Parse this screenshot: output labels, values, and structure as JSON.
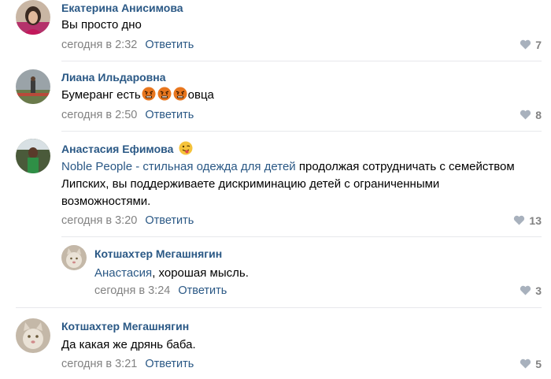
{
  "comments": [
    {
      "author": "Екатерина Анисимова",
      "text": "Вы просто дно",
      "time": "сегодня в 2:32",
      "reply": "Ответить",
      "likes": "7"
    },
    {
      "author": "Лиана Ильдаровна",
      "text_before": "Бумеранг есть",
      "text_after": "овца",
      "time": "сегодня в 2:50",
      "reply": "Ответить",
      "likes": "8"
    },
    {
      "author": "Анастасия Ефимова",
      "link_text": "Noble People - стильная одежда для детей",
      "text": " продолжая сотрудничать с семейством Липских, вы поддерживаете дискриминацию детей с ограниченными возможностями.",
      "time": "сегодня в 3:20",
      "reply": "Ответить",
      "likes": "13"
    },
    {
      "author": "Котшахтер Мегашнягин",
      "mention": "Анастасия",
      "text": ", хорошая мысль.",
      "time": "сегодня в 3:24",
      "reply": "Ответить",
      "likes": "3"
    },
    {
      "author": "Котшахтер Мегашнягин",
      "text": "Да какая же дрянь баба.",
      "time": "сегодня в 3:21",
      "reply": "Ответить",
      "likes": "5"
    }
  ],
  "colors": {
    "link": "#2a5885",
    "meta": "#828282",
    "separator": "#e7e8ec"
  },
  "icons": [
    "heart-icon",
    "angry-face-emoji",
    "tongue-wink-emoji"
  ]
}
